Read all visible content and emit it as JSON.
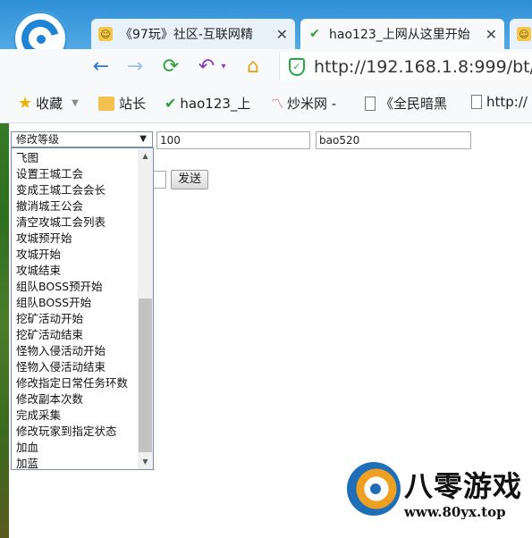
{
  "browser": {
    "tabs": [
      {
        "label": "《97玩》社区-互联网精",
        "icon": "face-icon"
      },
      {
        "label": "hao123_上网从这里开始",
        "icon": "hao123-icon"
      },
      {
        "label": "",
        "icon": "face-icon"
      }
    ],
    "address": "http://192.168.1.8:999/bt/",
    "accent_color": "#2e8fd6"
  },
  "bookmarks": [
    {
      "label": "收藏",
      "icon": "star-icon"
    },
    {
      "label": "站长",
      "icon": "folder-icon"
    },
    {
      "label": "hao123_上",
      "icon": "hao123-icon"
    },
    {
      "label": "炒米网 -",
      "icon": "chart-icon"
    },
    {
      "label": "《全民暗黑",
      "icon": "document-icon"
    },
    {
      "label": "http://",
      "icon": "document-icon"
    }
  ],
  "form": {
    "select_value": "修改等级",
    "amount_value": "100",
    "account_value": "bao520",
    "send_label": "发送",
    "options": [
      "飞图",
      "设置王城工会",
      "变成王城工会会长",
      "撤消城王公会",
      "清空攻城工会列表",
      "攻城预开始",
      "攻城开始",
      "攻城结束",
      "组队BOSS预开始",
      "组队BOSS开始",
      "挖矿活动开始",
      "挖矿活动结束",
      "怪物入侵活动开始",
      "怪物入侵活动结束",
      "修改指定日常任务环数",
      "修改副本次数",
      "完成采集",
      "修改玩家到指定状态",
      "加血",
      "加蓝"
    ]
  },
  "watermark": {
    "title": "八零游戏",
    "url": "www.80yx.top"
  }
}
